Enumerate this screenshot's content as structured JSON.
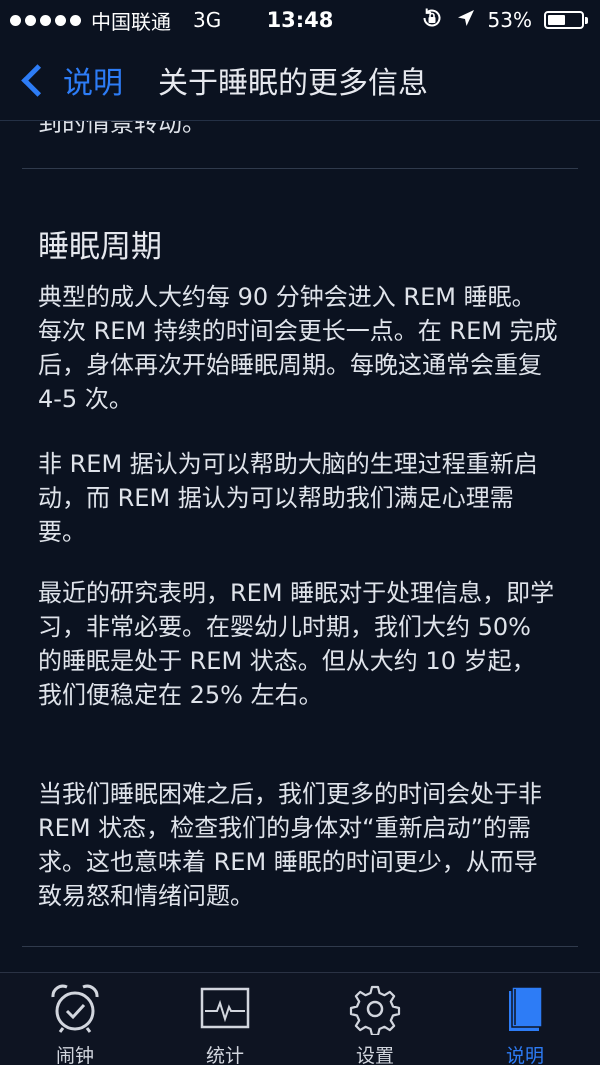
{
  "status_bar": {
    "carrier": "中国联通",
    "network": "3G",
    "time": "13:48",
    "battery_percent": "53%",
    "battery_level": 0.53
  },
  "nav": {
    "back_label": "说明",
    "title": "关于睡眠的更多信息"
  },
  "content": {
    "cut_text": "到的情景转动。",
    "section_title": "睡眠周期",
    "paragraphs": [
      "典型的成人大约每 90 分钟会进入 REM 睡眠。每次 REM 持续的时间会更长一点。在 REM 完成后，身体再次开始睡眠周期。每晚这通常会重复 4-5 次。",
      "非 REM 据认为可以帮助大脑的生理过程重新启动，而 REM 据认为可以帮助我们满足心理需要。",
      "最近的研究表明，REM 睡眠对于处理信息，即学习，非常必要。在婴幼儿时期，我们大约 50% 的睡眠是处于 REM 状态。但从大约 10 岁起，我们便稳定在 25% 左右。",
      "当我们睡眠困难之后，我们更多的时间会处于非 REM 状态，检查我们的身体对“重新启动”的需求。这也意味着 REM 睡眠的时间更少，从而导致易怒和情绪问题。"
    ]
  },
  "tabs": [
    {
      "label": "闹钟",
      "icon": "alarm-clock-icon"
    },
    {
      "label": "统计",
      "icon": "stats-graph-icon"
    },
    {
      "label": "设置",
      "icon": "gear-icon"
    },
    {
      "label": "说明",
      "icon": "book-icon",
      "active": true
    }
  ],
  "colors": {
    "background": "#0b1220",
    "accent": "#2d7cf6",
    "text": "#dfe3ea",
    "tab_inactive": "#d2d6de"
  }
}
